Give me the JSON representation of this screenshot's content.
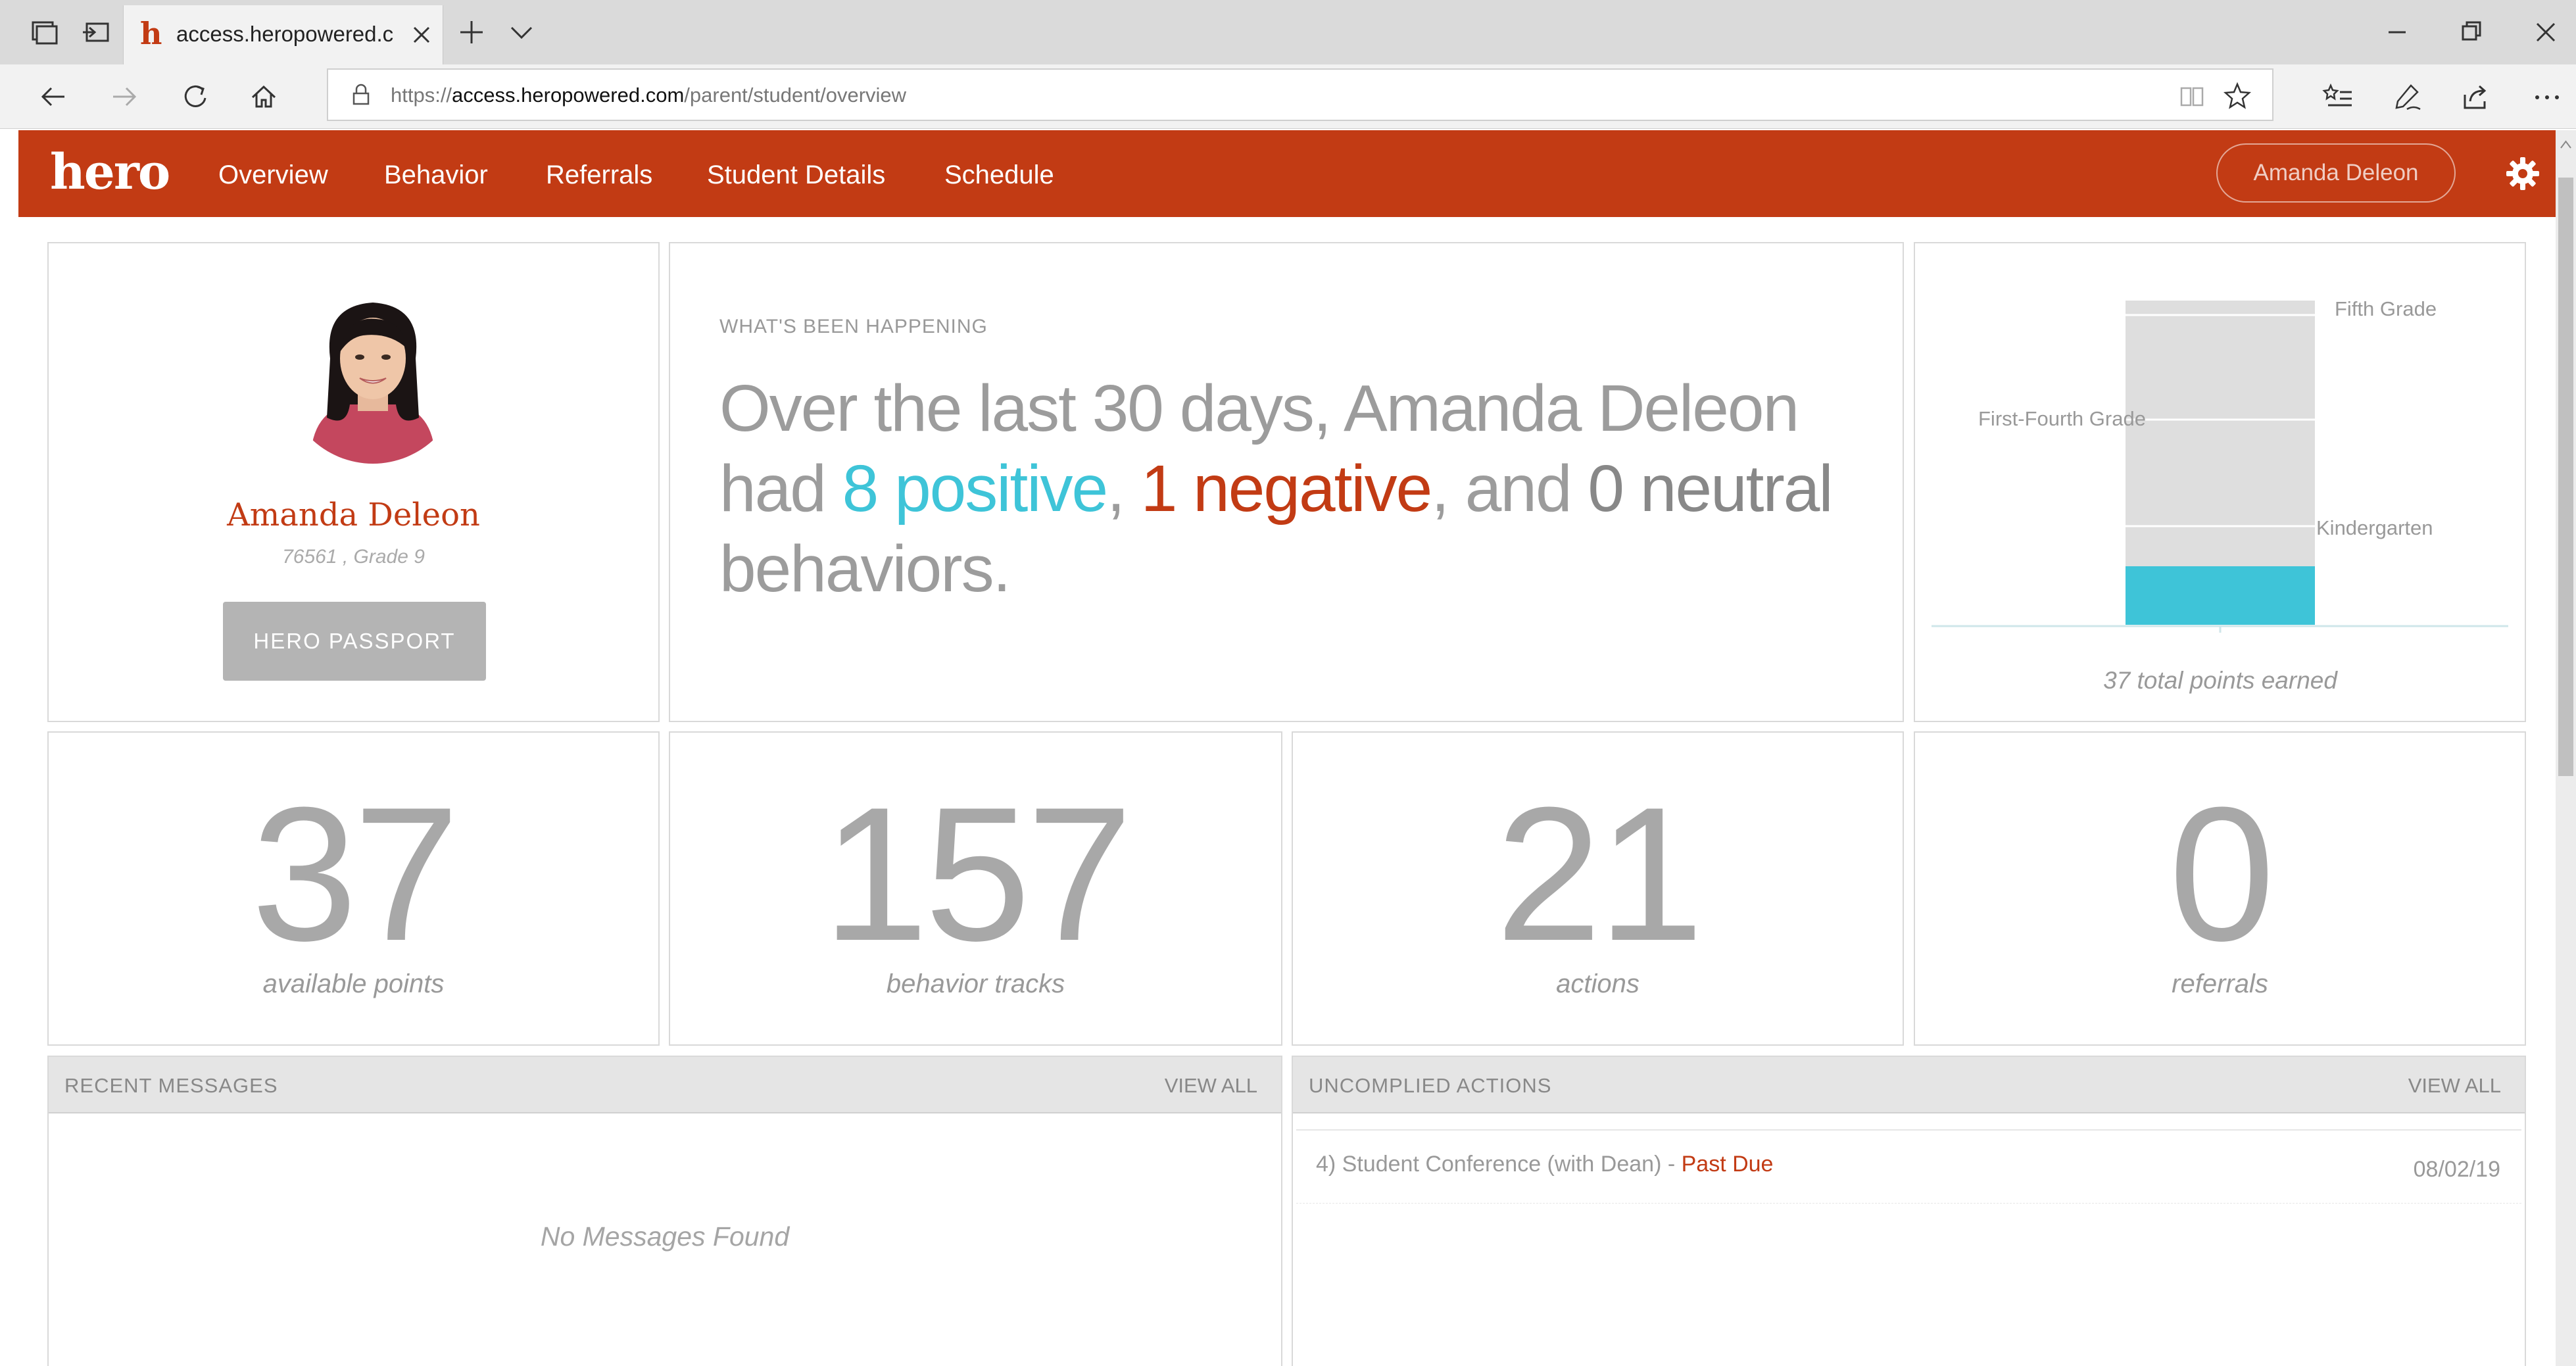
{
  "browser": {
    "tab": {
      "title": "access.heropowered.com"
    },
    "url": {
      "protocol": "https://",
      "domain": "access.heropowered.com",
      "path": "/parent/student/overview"
    }
  },
  "header": {
    "logo": "hero",
    "nav": [
      "Overview",
      "Behavior",
      "Referrals",
      "Student Details",
      "Schedule"
    ],
    "user": "Amanda Deleon"
  },
  "profile": {
    "name": "Amanda Deleon",
    "meta": "76561 , Grade 9",
    "passport_button": "HERO PASSPORT"
  },
  "happening": {
    "label": "WHAT'S BEEN HAPPENING",
    "intro": "Over the last 30 days, Amanda Deleon had ",
    "positive_count": "8",
    "positive_word": "positive",
    "sep1": ", ",
    "negative_count": "1",
    "negative_word": "negative",
    "sep2": ", and ",
    "neutral_count": "0",
    "neutral_word": "neutral",
    "outro": " behaviors."
  },
  "chart_data": {
    "type": "bar",
    "levels": [
      "Kindergarten",
      "First-Fourth Grade",
      "Fifth Grade"
    ],
    "earned_fraction": 0.18,
    "caption": "37 total points earned",
    "colors": {
      "filled": "#3ec4d8",
      "empty": "#dedede"
    }
  },
  "stats": [
    {
      "value": "37",
      "label": "available points"
    },
    {
      "value": "157",
      "label": "behavior tracks"
    },
    {
      "value": "21",
      "label": "actions"
    },
    {
      "value": "0",
      "label": "referrals"
    }
  ],
  "messages": {
    "title": "RECENT MESSAGES",
    "view_all": "VIEW ALL",
    "empty": "No Messages Found"
  },
  "actions": {
    "title": "UNCOMPLIED ACTIONS",
    "view_all": "VIEW ALL",
    "items": [
      {
        "text": "4) Student Conference (with Dean) - ",
        "status": "Past Due",
        "date": "08/02/19"
      }
    ]
  },
  "colors": {
    "brand": "#c23b14",
    "positive": "#3ec4d8",
    "negative": "#c23b14"
  }
}
